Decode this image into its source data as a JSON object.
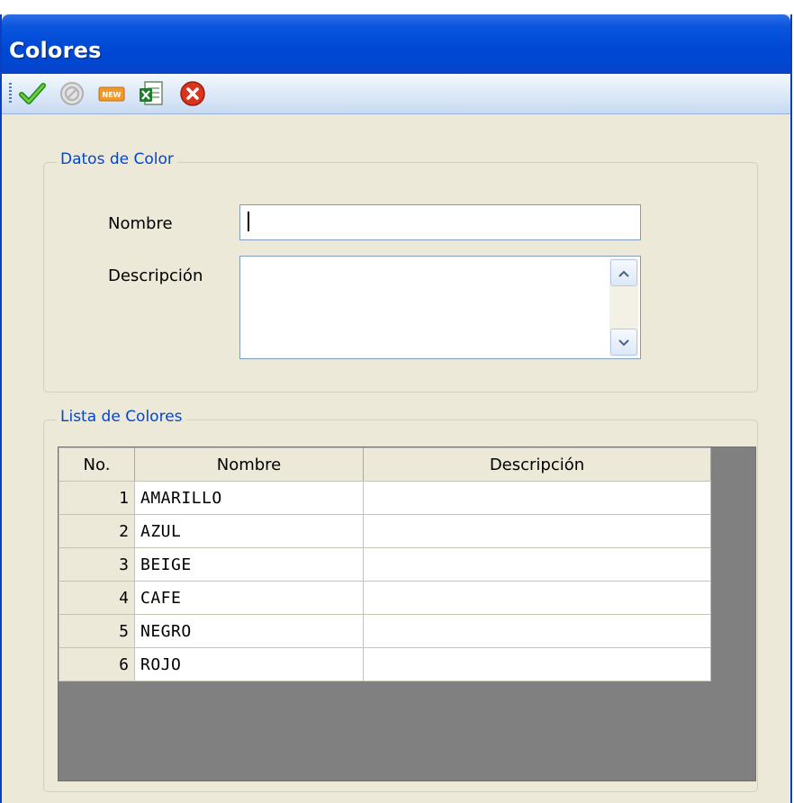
{
  "window": {
    "title": "Colores"
  },
  "toolbar": {
    "buttons": [
      {
        "name": "accept-button",
        "icon": "checkmark-icon"
      },
      {
        "name": "disabled-button",
        "icon": "disabled-icon"
      },
      {
        "name": "new-button",
        "icon": "new-icon",
        "text": "NEW"
      },
      {
        "name": "excel-button",
        "icon": "excel-icon"
      },
      {
        "name": "close-button",
        "icon": "close-icon"
      }
    ]
  },
  "datos": {
    "legend": "Datos de Color",
    "nombre_label": "Nombre",
    "nombre_value": "",
    "descripcion_label": "Descripción",
    "descripcion_value": ""
  },
  "lista": {
    "legend": "Lista de Colores",
    "columns": [
      "No.",
      "Nombre",
      "Descripción"
    ],
    "rows": [
      {
        "no": "1",
        "nombre": "AMARILLO",
        "descripcion": ""
      },
      {
        "no": "2",
        "nombre": "AZUL",
        "descripcion": ""
      },
      {
        "no": "3",
        "nombre": "BEIGE",
        "descripcion": ""
      },
      {
        "no": "4",
        "nombre": "CAFE",
        "descripcion": ""
      },
      {
        "no": "5",
        "nombre": "NEGRO",
        "descripcion": ""
      },
      {
        "no": "6",
        "nombre": "ROJO",
        "descripcion": ""
      }
    ]
  },
  "colors": {
    "titlebar": "#0048d2",
    "legend_text": "#0046d5",
    "form_bg": "#ece9d8",
    "grid_empty": "#808080"
  }
}
